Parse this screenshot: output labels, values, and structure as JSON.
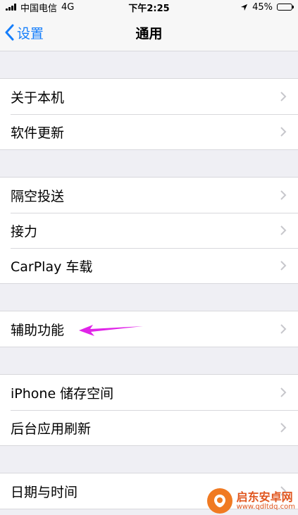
{
  "status_bar": {
    "carrier": "中国电信",
    "network": "4G",
    "time": "下午2:25",
    "battery": "45%",
    "battery_level": 0.45
  },
  "nav": {
    "back_label": "设置",
    "title": "通用"
  },
  "groups": [
    {
      "items": [
        {
          "label": "关于本机"
        },
        {
          "label": "软件更新"
        }
      ]
    },
    {
      "items": [
        {
          "label": "隔空投送"
        },
        {
          "label": "接力"
        },
        {
          "label": "CarPlay 车载"
        }
      ]
    },
    {
      "items": [
        {
          "label": "辅助功能"
        }
      ]
    },
    {
      "items": [
        {
          "label": "iPhone 储存空间"
        },
        {
          "label": "后台应用刷新"
        }
      ]
    },
    {
      "items": [
        {
          "label": "日期与时间"
        }
      ]
    }
  ],
  "watermark": {
    "name": "启东安卓网",
    "url": "www.qdltdq.com"
  },
  "colors": {
    "accent": "#157efb",
    "annotation_arrow": "#e024e8"
  }
}
